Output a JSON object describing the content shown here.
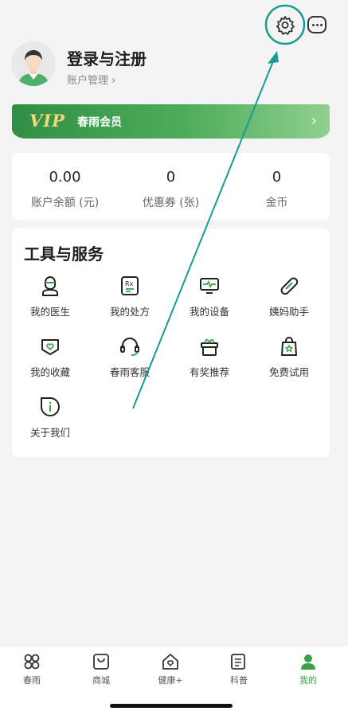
{
  "profile": {
    "username": "登录与注册",
    "account_label": "账户管理 ›"
  },
  "vip": {
    "mark": "VIP",
    "label": "春雨会员",
    "arrow": "›"
  },
  "stats": [
    {
      "value": "0.00",
      "label": "账户余额 (元)"
    },
    {
      "value": "0",
      "label": "优惠券 (张)"
    },
    {
      "value": "0",
      "label": "金币"
    }
  ],
  "tools": {
    "title": "工具与服务",
    "items": [
      {
        "label": "我的医生",
        "icon": "doctor-icon"
      },
      {
        "label": "我的处方",
        "icon": "prescription-icon"
      },
      {
        "label": "我的设备",
        "icon": "device-icon"
      },
      {
        "label": "姨妈助手",
        "icon": "period-assistant-icon"
      },
      {
        "label": "我的收藏",
        "icon": "favorites-icon"
      },
      {
        "label": "春雨客服",
        "icon": "customer-service-icon"
      },
      {
        "label": "有奖推荐",
        "icon": "gift-icon"
      },
      {
        "label": "免费试用",
        "icon": "free-trial-icon"
      },
      {
        "label": "关于我们",
        "icon": "about-icon"
      }
    ]
  },
  "tabbar": [
    {
      "label": "春雨",
      "icon": "chunyu-icon"
    },
    {
      "label": "商城",
      "icon": "shop-icon"
    },
    {
      "label": "健康+",
      "icon": "health-icon"
    },
    {
      "label": "科普",
      "icon": "science-icon"
    },
    {
      "label": "我的",
      "icon": "profile-icon",
      "active": true
    }
  ],
  "colors": {
    "accent": "#3aa14a",
    "annotation": "#1a9a93",
    "vip_gold": "#f5d77a"
  }
}
